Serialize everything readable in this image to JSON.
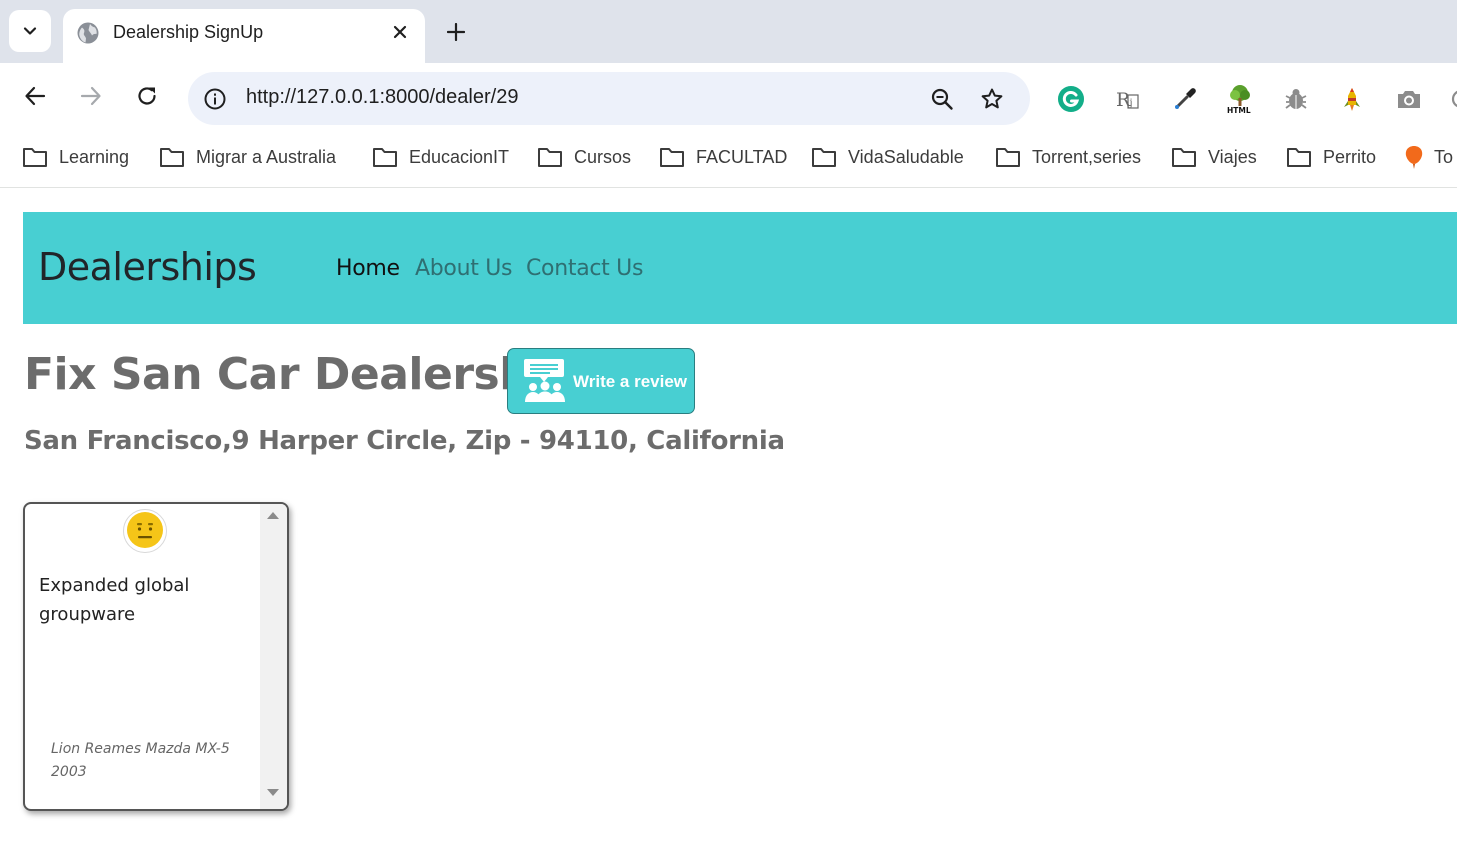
{
  "browser": {
    "tab": {
      "title": "Dealership SignUp"
    },
    "address_bar": {
      "url": "http://127.0.0.1:8000/dealer/29"
    },
    "extensions": [
      "grammarly-icon",
      "rx-icon",
      "eyedropper-icon",
      "html-tree-icon",
      "bug-icon",
      "rocket-icon",
      "camera-icon"
    ],
    "bookmarks": [
      {
        "label": "Learning",
        "icon": "folder-icon"
      },
      {
        "label": "Migrar a Australia",
        "icon": "folder-icon"
      },
      {
        "label": "EducacionIT",
        "icon": "folder-icon"
      },
      {
        "label": "Cursos",
        "icon": "folder-icon"
      },
      {
        "label": "FACULTAD",
        "icon": "folder-icon"
      },
      {
        "label": "VidaSaludable",
        "icon": "folder-icon"
      },
      {
        "label": "Torrent,series",
        "icon": "folder-icon"
      },
      {
        "label": "Viajes",
        "icon": "folder-icon"
      },
      {
        "label": "Perrito",
        "icon": "folder-icon"
      },
      {
        "label": "To",
        "icon": "balloon-icon"
      }
    ]
  },
  "navbar": {
    "brand": "Dealerships",
    "links": [
      {
        "label": "Home",
        "active": true
      },
      {
        "label": "About Us",
        "active": false
      },
      {
        "label": "Contact Us",
        "active": false
      }
    ],
    "background_color": "#48cfd2"
  },
  "dealer": {
    "name": "Fix San Car Dealership",
    "address": "San Francisco,9 Harper Circle, Zip - 94110, California",
    "write_review_label": "Write a review"
  },
  "reviews": [
    {
      "sentiment_icon": "neutral-face-icon",
      "text": "Expanded global groupware",
      "author_car": "Lion Reames Mazda MX-5 2003"
    }
  ]
}
